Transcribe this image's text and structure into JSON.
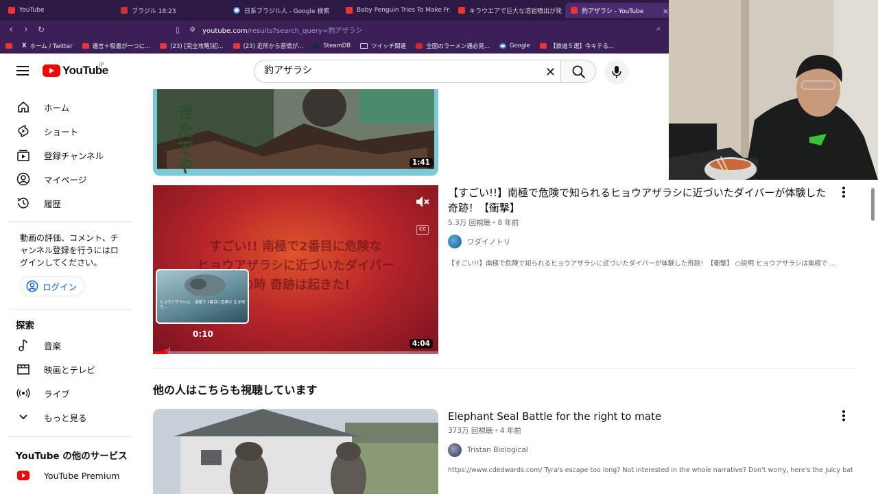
{
  "browser": {
    "tabs": [
      {
        "title": "YouTube",
        "favicon": "youtube-favicon"
      },
      {
        "title": "ブラジル 18:23",
        "favicon": "bookmark-favicon"
      },
      {
        "title": "日系ブラジル人 - Google 検索",
        "favicon": "google-favicon"
      },
      {
        "title": "Baby Penguin Tries To Make Friends",
        "favicon": "youtube-favicon"
      },
      {
        "title": "キラウエアで巨大な溶岩噴出が発生。ウ",
        "favicon": "youtube-favicon"
      },
      {
        "title": "豹アザラシ - YouTube",
        "favicon": "youtube-favicon"
      }
    ],
    "close_tab": "×",
    "url_host": "youtube.com",
    "url_rest": "/results?search_query=豹アザラシ",
    "bookmarks": [
      {
        "label": "ホーム / Twitter",
        "favicon": "x-favicon"
      },
      {
        "label": "遺言＋吸書が一つに...",
        "favicon": "bookmark-favicon"
      },
      {
        "label": "(23) [完全攻略]初...",
        "favicon": "youtube-favicon"
      },
      {
        "label": "(23) 近所から苦情が...",
        "favicon": "youtube-favicon"
      },
      {
        "label": "SteamDB",
        "favicon": "steam-favicon"
      },
      {
        "label": "ツイッチ関連",
        "favicon": "folder-favicon"
      },
      {
        "label": "全国のラーメン通必見...",
        "favicon": "ramen-favicon"
      },
      {
        "label": "Google",
        "favicon": "google-favicon"
      },
      {
        "label": "【鉄道５選】今キテる...",
        "favicon": "youtube-favicon"
      }
    ]
  },
  "header": {
    "logo_text": "YouTube",
    "logo_country": "JP",
    "search_value": "豹アザラシ",
    "clear_icon": "✕"
  },
  "sidebar": {
    "items": [
      {
        "label": "ホーム",
        "icon": "home-icon"
      },
      {
        "label": "ショート",
        "icon": "shorts-icon"
      },
      {
        "label": "登録チャンネル",
        "icon": "subscriptions-icon"
      },
      {
        "label": "マイページ",
        "icon": "account-icon"
      },
      {
        "label": "履歴",
        "icon": "history-icon"
      }
    ],
    "login_prompt": "動画の評価、コメント、チャンネル登録を行うにはログインしてください。",
    "login_label": "ログイン",
    "explore_heading": "探索",
    "explore_items": [
      {
        "label": "音楽",
        "icon": "music-icon"
      },
      {
        "label": "映画とテレビ",
        "icon": "film-icon"
      },
      {
        "label": "ライブ",
        "icon": "live-icon"
      },
      {
        "label": "もっと見る",
        "icon": "chevron-down-icon"
      }
    ],
    "more_heading": "YouTube の他のサービス",
    "more_items": [
      {
        "label": "YouTube Premium",
        "icon": "youtube-premium-icon"
      }
    ]
  },
  "results": [
    {
      "duration": "1:41",
      "thumb_text": "きたでや"
    },
    {
      "title": "【すごい!!】南極で危険で知られるヒョウアザラシに近づいたダイバーが体験した奇跡！【衝撃】",
      "meta": "5.3万 回視聴・8 年前",
      "channel": "ワダイノトリ",
      "description": "【すごい!!】南極で危険で知られるヒョウアザラシに近づいたダイバーが体験した奇跡！【衝撃】 ○説明 ヒョウアザラシは南極で ...",
      "duration": "4:04",
      "thumb_text_line1": "すごい!! 南極で2番目に危険な",
      "thumb_text_line2": "ヒョウアザラシに近づいたダイバー",
      "thumb_text_line3": "の時 奇跡は起きた!",
      "preview_time": "0:10",
      "preview_caption": "ヒョウアザラシは... 南極で 2番目に危険な 生き物 で...",
      "progress_fraction": 0.04
    }
  ],
  "section_heading": "他の人はこちらも視聴しています",
  "related": [
    {
      "title": "Elephant Seal Battle for the right to mate",
      "meta": "373万 回視聴・4 年前",
      "channel": "Tristan Biological",
      "description": "https://www.cdedwards.com/ Tyra's escape too long? Not interested in the whole narrative? Don't worry, here's the juicy battle ..."
    }
  ],
  "colors": {
    "youtube_red": "#ff0000",
    "link_blue": "#065fd4",
    "browser_purple": "#2d1a44"
  }
}
